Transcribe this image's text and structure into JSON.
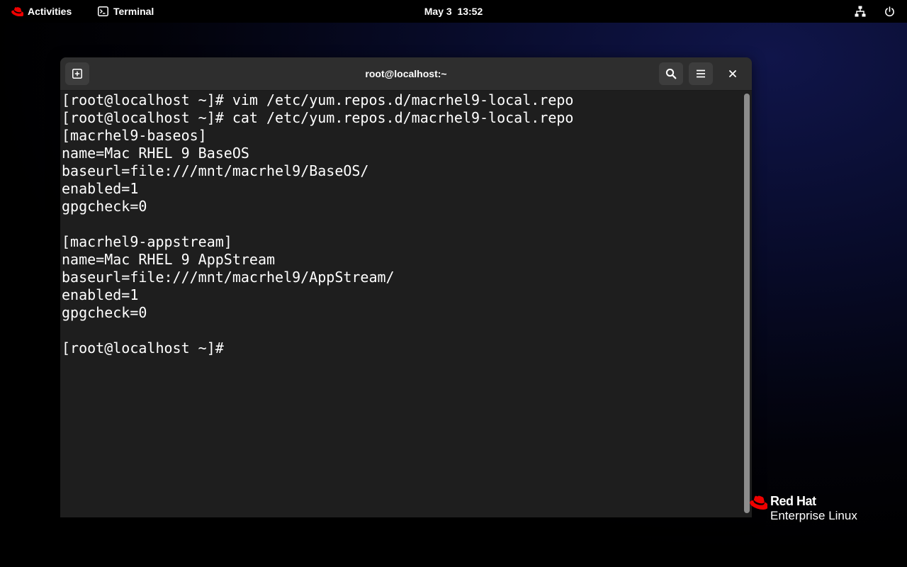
{
  "topbar": {
    "activities_label": "Activities",
    "app_name": "Terminal",
    "clock": "May 3  13:52",
    "tray_icons": [
      "network-icon",
      "power-icon"
    ]
  },
  "window": {
    "title": "root@localhost:~",
    "buttons": [
      "new-tab-icon",
      "search-icon",
      "menu-icon",
      "close-icon"
    ]
  },
  "terminal": {
    "lines": [
      "[root@localhost ~]# vim /etc/yum.repos.d/macrhel9-local.repo",
      "[root@localhost ~]# cat /etc/yum.repos.d/macrhel9-local.repo",
      "[macrhel9-baseos]",
      "name=Mac RHEL 9 BaseOS",
      "baseurl=file:///mnt/macrhel9/BaseOS/",
      "enabled=1",
      "gpgcheck=0",
      "",
      "[macrhel9-appstream]",
      "name=Mac RHEL 9 AppStream",
      "baseurl=file:///mnt/macrhel9/AppStream/",
      "enabled=1",
      "gpgcheck=0",
      "",
      "[root@localhost ~]#"
    ]
  },
  "brand": {
    "name": "Red Hat",
    "product": "Enterprise Linux"
  },
  "colors": {
    "topbar_bg": "#000000",
    "headerbar_bg": "#2e2e2e",
    "terminal_bg": "#1e1e1e",
    "terminal_fg": "#ffffff",
    "redhat_red": "#ee0000"
  }
}
